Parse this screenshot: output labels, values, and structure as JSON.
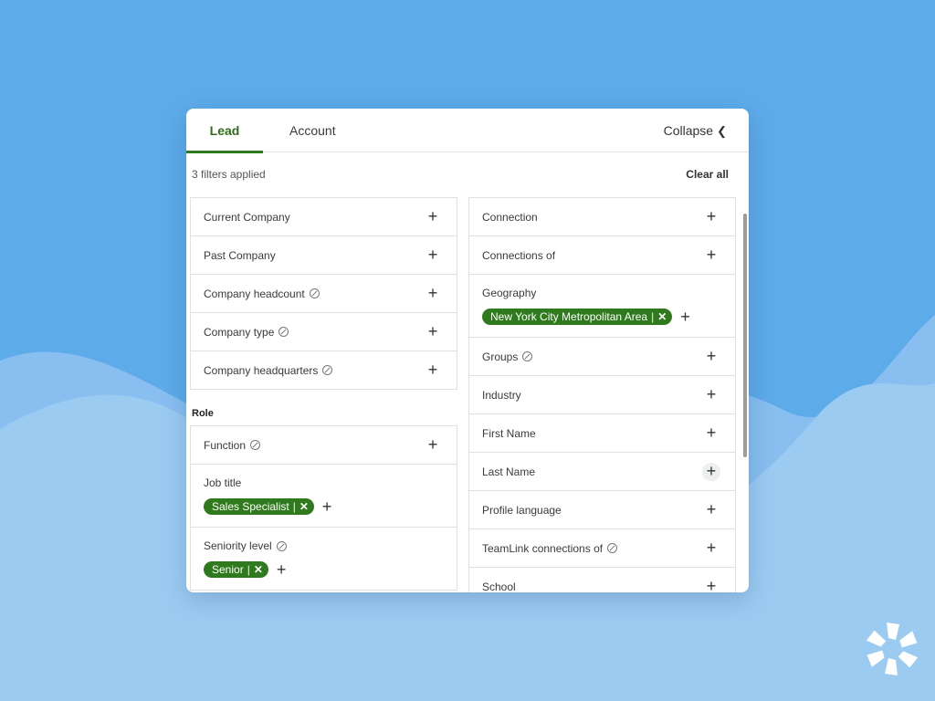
{
  "tabs": {
    "lead": "Lead",
    "account": "Account"
  },
  "collapse": {
    "label": "Collapse",
    "chevron": "❮"
  },
  "filterbar": {
    "count_text": "3 filters applied",
    "clear_all": "Clear all"
  },
  "left": {
    "company_rows": [
      {
        "label": "Current Company"
      },
      {
        "label": "Past Company"
      },
      {
        "label": "Company headcount"
      },
      {
        "label": "Company type"
      },
      {
        "label": "Company headquarters"
      }
    ],
    "role_title": "Role",
    "function_label": "Function",
    "job_title": {
      "label": "Job title",
      "chip": "Sales Specialist"
    },
    "seniority": {
      "label": "Seniority level",
      "chip": "Senior"
    }
  },
  "right": {
    "connection": "Connection",
    "connections_of": "Connections of",
    "geography": {
      "label": "Geography",
      "chip": "New York City Metropolitan Area"
    },
    "groups": "Groups",
    "industry": "Industry",
    "first_name": "First Name",
    "last_name": "Last Name",
    "profile_language": "Profile language",
    "teamlink": "TeamLink connections of",
    "school": "School"
  },
  "colors": {
    "accent": "#2f7a1d",
    "background": "#5eabea",
    "wave_light": "#9ccbf2"
  },
  "icons": {
    "plus": "+",
    "remove": "✕",
    "info": "info-icon",
    "logo": "brand-logo-icon"
  }
}
